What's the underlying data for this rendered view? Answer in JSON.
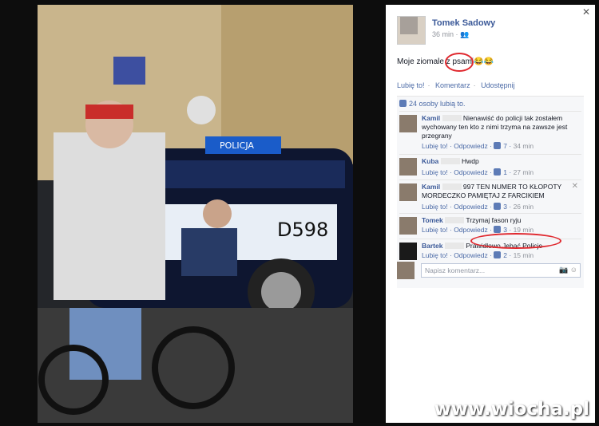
{
  "photo": {
    "plate": "D598",
    "car_sign": "POLICJA"
  },
  "post": {
    "author": "Tomek Sadowy",
    "time": "36 min",
    "text_before": "Moje ziomale z ",
    "text_highlight": "psami",
    "emoji": "😂😂",
    "actions": [
      "Lubię to!",
      "Komentarz",
      "Udostępnij"
    ]
  },
  "likes": {
    "text": "24 osoby lubią to."
  },
  "comments": [
    {
      "name": "Kamil",
      "text": "Nienawiść do policji tak zostałem wychowany ten kto z nimi trzyma na zawsze jest przegrany",
      "likes": "7",
      "time": "34 min"
    },
    {
      "name": "Kuba",
      "text": "Hwdp",
      "likes": "1",
      "time": "27 min"
    },
    {
      "name": "Kamil",
      "text": "997 TEN NUMER TO KŁOPOTY MORDECZKO PAMIĘTAJ Z FARCIKIEM",
      "likes": "3",
      "time": "26 min"
    },
    {
      "name": "Tomek",
      "text": "Trzymaj fason ryju",
      "likes": "3",
      "time": "19 min"
    },
    {
      "name": "Bartek",
      "text": "Prawidłowo Jebać Policje",
      "likes": "2",
      "time": "15 min"
    }
  ],
  "comment_meta": {
    "like_label": "Lubię to!",
    "reply_label": "Odpowiedz",
    "sep": "·"
  },
  "composer": {
    "placeholder": "Napisz komentarz..."
  },
  "watermark": "www.wiocha.pl",
  "colors": {
    "link": "#3b5998",
    "highlight_circle": "#e0282e"
  }
}
